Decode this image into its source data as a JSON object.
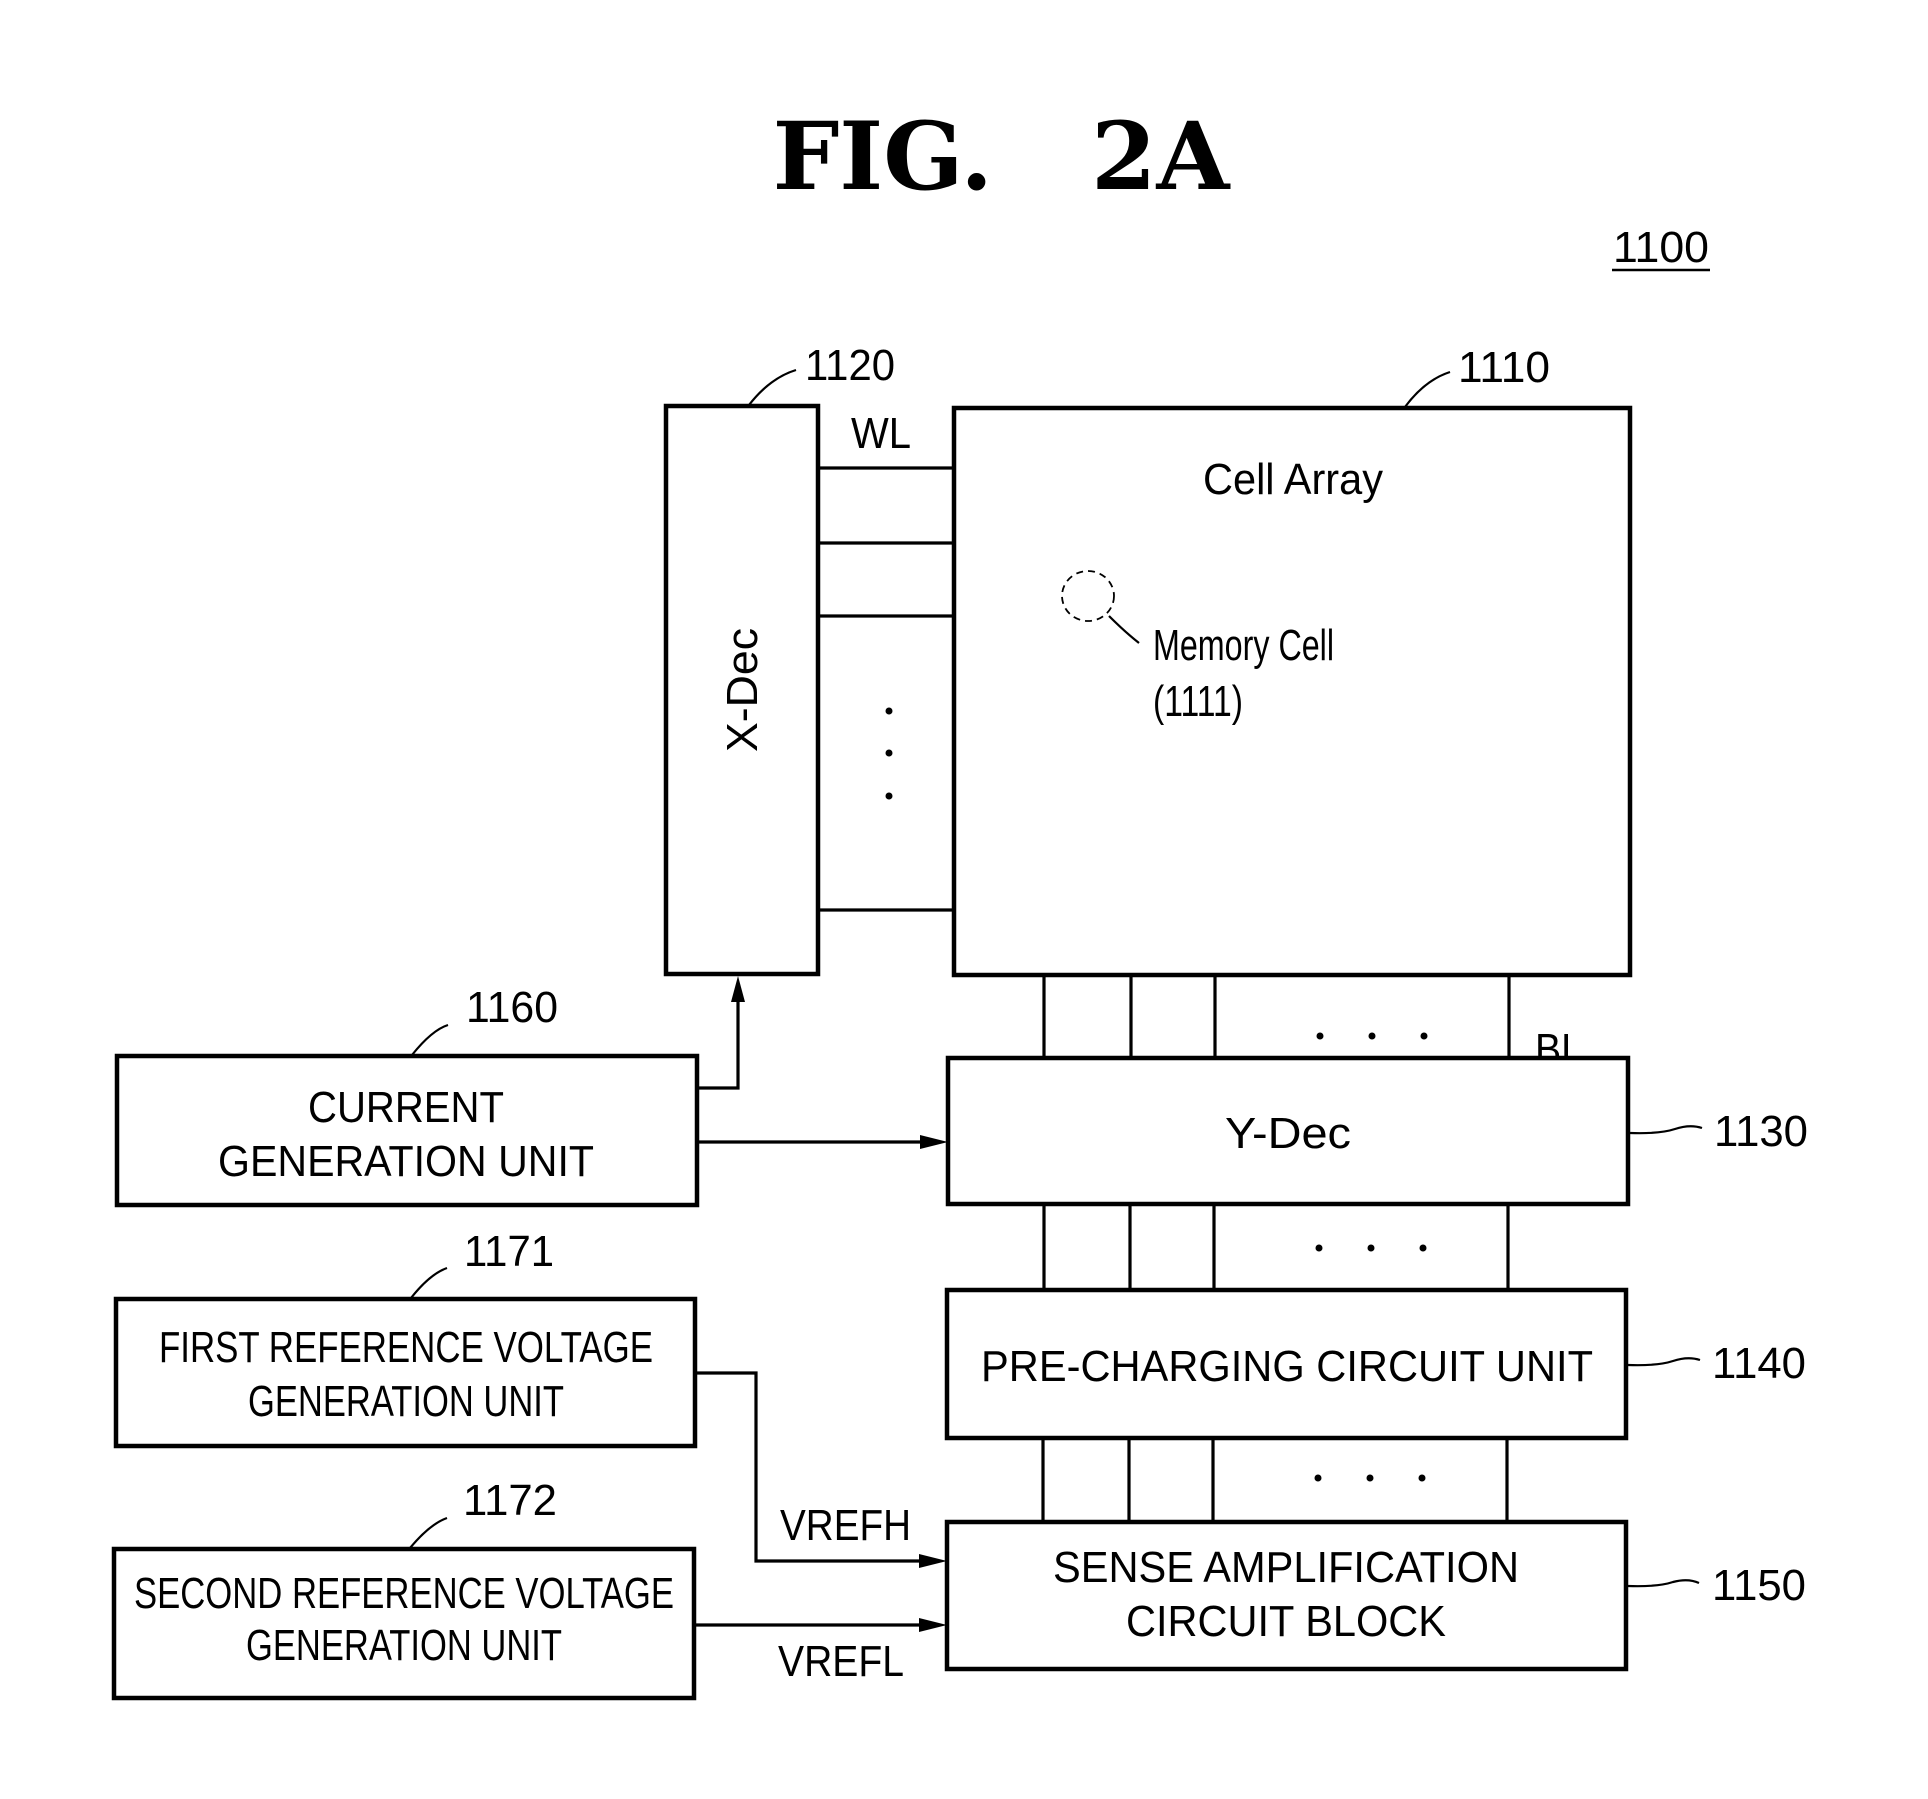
{
  "figure": {
    "title": "FIG.   2A",
    "reference_number": "1100"
  },
  "blocks": {
    "cell_array": {
      "ref": "1110",
      "label": "Cell Array"
    },
    "x_decoder": {
      "ref": "1120",
      "label": "X-Dec"
    },
    "y_decoder": {
      "ref": "1130",
      "label": "Y-Dec"
    },
    "precharging": {
      "ref": "1140",
      "label": "PRE-CHARGING CIRCUIT UNIT"
    },
    "sense_amp": {
      "ref": "1150",
      "label_line1": "SENSE AMPLIFICATION",
      "label_line2": "CIRCUIT BLOCK"
    },
    "current_gen": {
      "ref": "1160",
      "label_line1": "CURRENT",
      "label_line2": "GENERATION UNIT"
    },
    "first_ref": {
      "ref": "1171",
      "label_line1": "FIRST REFERENCE VOLTAGE",
      "label_line2": "GENERATION UNIT"
    },
    "second_ref": {
      "ref": "1172",
      "label_line1": "SECOND REFERENCE VOLTAGE",
      "label_line2": "GENERATION UNIT"
    }
  },
  "memory_cell": {
    "label": "Memory Cell",
    "ref": "(1111)"
  },
  "signals": {
    "word_line": "WL",
    "bit_line": "BL",
    "vref_high": "VREFH",
    "vref_low": "VREFL"
  },
  "ellipsis": {
    "dot_count": 3
  }
}
